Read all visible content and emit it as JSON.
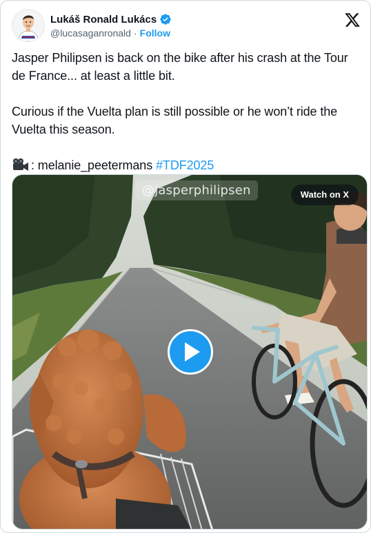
{
  "author": {
    "name": "Lukáš Ronald Lukács",
    "handle": "@lucasaganronald",
    "separator": "·",
    "follow_label": "Follow"
  },
  "icons": {
    "verified": "verified-badge-icon",
    "logo": "x-logo-icon",
    "camera": "movie-camera-icon",
    "play": "play-icon"
  },
  "tweet": {
    "paragraph1": "Jasper Philipsen is back on the bike after his crash at the Tour de France... at least a little bit.",
    "paragraph2": "Curious if the Vuelta plan is still possible or he won’t ride the Vuelta this season.",
    "credit_emoji": "🎥",
    "credit_text": ": melanie_peetermans ",
    "hashtag": "#TDF2025"
  },
  "media": {
    "watermark": "@jasperphilipsen",
    "watch_label": "Watch on X"
  },
  "colors": {
    "accent": "#1d9bf0",
    "text": "#0f1419",
    "secondary": "#536471",
    "verified": "#1d9bf0"
  }
}
